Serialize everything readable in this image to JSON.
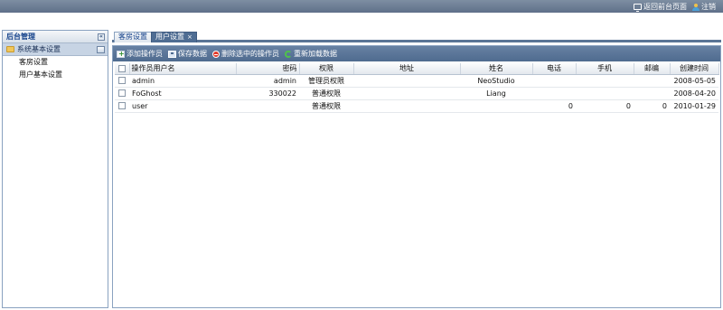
{
  "header": {
    "links": [
      {
        "label": "返回前台页面",
        "icon": "monitor-icon"
      },
      {
        "label": "注销",
        "icon": "user-logout-icon"
      }
    ]
  },
  "sidebar": {
    "title": "后台管理",
    "section": {
      "label": "系统基本设置",
      "icon": "folder-open-icon"
    },
    "items": [
      {
        "label": "客房设置"
      },
      {
        "label": "用户基本设置"
      }
    ]
  },
  "tabs": [
    {
      "label": "客房设置",
      "active": false
    },
    {
      "label": "用户设置",
      "active": true,
      "closable": true
    }
  ],
  "toolbar": {
    "buttons": [
      {
        "label": "添加操作员",
        "icon": "add-icon"
      },
      {
        "label": "保存数据",
        "icon": "save-icon"
      },
      {
        "label": "删除选中的操作员",
        "icon": "delete-icon"
      },
      {
        "label": "重新加载数据",
        "icon": "reload-icon"
      }
    ]
  },
  "grid": {
    "columns": [
      "操作员用户名",
      "密码",
      "权限",
      "地址",
      "姓名",
      "电话",
      "手机",
      "邮编",
      "创建时间"
    ],
    "rows": [
      {
        "username": "admin",
        "password": "admin",
        "permission": "管理员权限",
        "address": "",
        "name": "NeoStudio",
        "phone": "",
        "mobile": "",
        "zip": "",
        "created": "2008-05-05"
      },
      {
        "username": "FoGhost",
        "password": "330022",
        "permission": "普通权限",
        "address": "",
        "name": "Liang",
        "phone": "",
        "mobile": "",
        "zip": "",
        "created": "2008-04-20"
      },
      {
        "username": "user",
        "password": "",
        "permission": "普通权限",
        "address": "",
        "name": "",
        "phone": "0",
        "mobile": "0",
        "zip": "0",
        "created": "2010-01-29"
      }
    ]
  },
  "colors": {
    "topbar": "#6a7b92",
    "toolbar": "#5a7596",
    "active_tab": "#4f6d93",
    "panel_border": "#8aa2c0"
  }
}
